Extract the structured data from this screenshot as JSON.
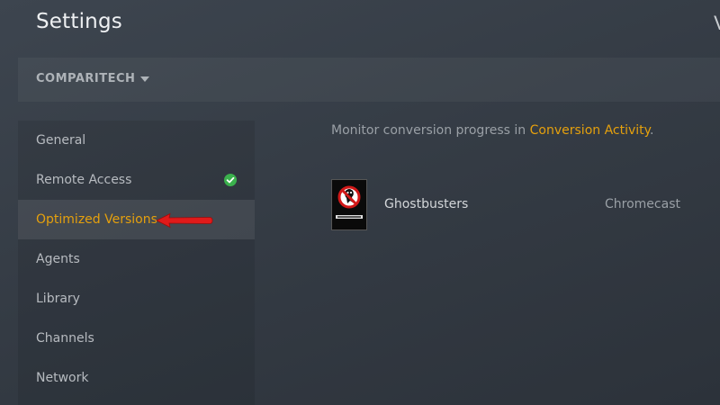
{
  "header": {
    "title": "Settings",
    "right_partial": "V"
  },
  "server": {
    "name": "COMPARITECH"
  },
  "sidebar": {
    "items": [
      {
        "label": "General"
      },
      {
        "label": "Remote Access",
        "status": "check-icon"
      },
      {
        "label": "Optimized Versions",
        "active": true
      },
      {
        "label": "Agents"
      },
      {
        "label": "Library"
      },
      {
        "label": "Channels"
      },
      {
        "label": "Network"
      }
    ]
  },
  "main": {
    "monitor_text": "Monitor conversion progress in ",
    "monitor_link": "Conversion Activity",
    "monitor_suffix": ".",
    "items": [
      {
        "title": "Ghostbusters",
        "device": "Chromecast",
        "poster_icon": "ghostbusters-logo-icon"
      }
    ]
  },
  "colors": {
    "accent": "#e5a00d",
    "success": "#3bb14d",
    "annotation_arrow": "#e01a1a"
  }
}
